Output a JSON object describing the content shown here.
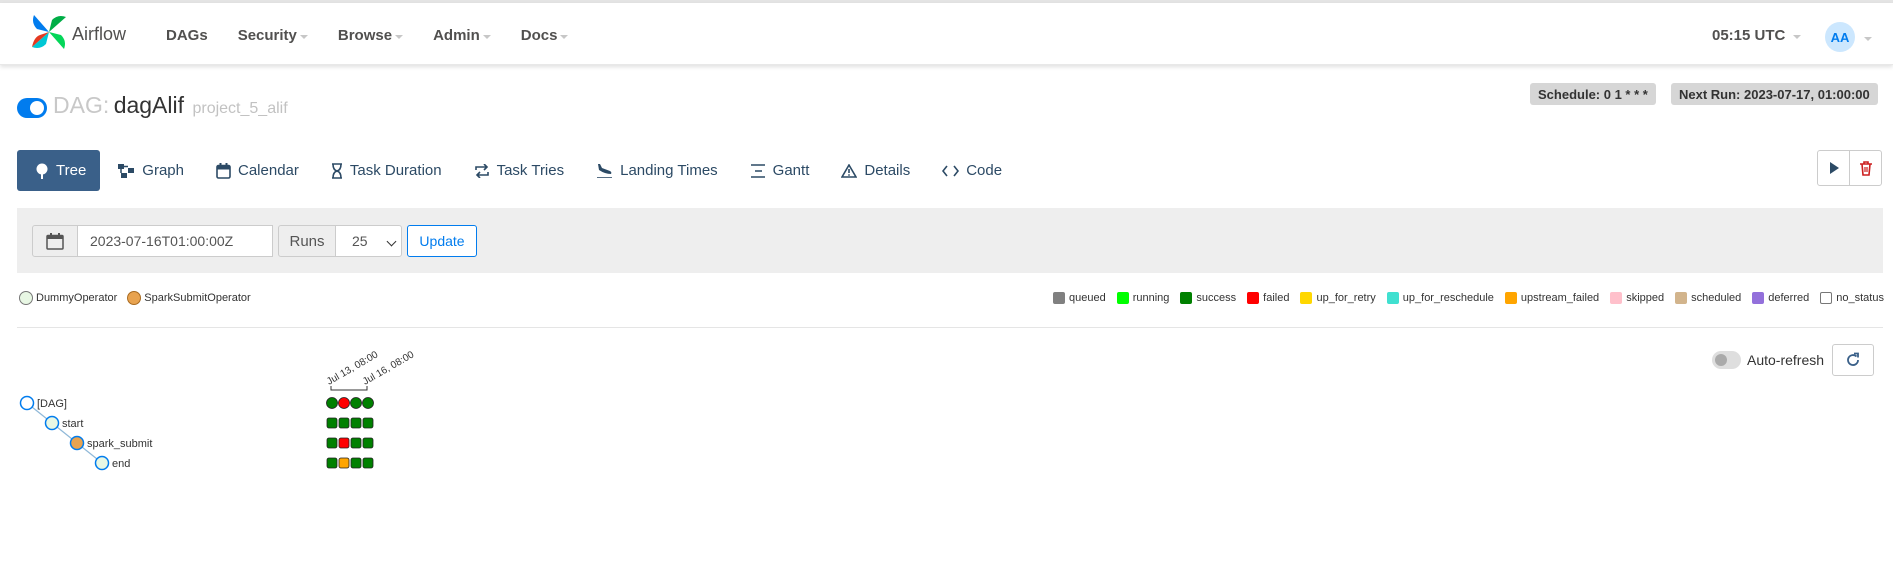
{
  "app": {
    "brand": "Airflow"
  },
  "nav": {
    "menu": [
      {
        "label": "DAGs",
        "dropdown": false
      },
      {
        "label": "Security",
        "dropdown": true
      },
      {
        "label": "Browse",
        "dropdown": true
      },
      {
        "label": "Admin",
        "dropdown": true
      },
      {
        "label": "Docs",
        "dropdown": true
      }
    ],
    "time": "05:15 UTC",
    "user_initials": "AA"
  },
  "dag": {
    "paused": false,
    "prefix": "DAG:",
    "name": "dagAlif",
    "tag": "project_5_alif",
    "schedule": "Schedule: 0 1 * * *",
    "next_run": "Next Run: 2023-07-17, 01:00:00"
  },
  "tabs": [
    {
      "label": "Tree",
      "icon": "tree-icon",
      "active": true
    },
    {
      "label": "Graph",
      "icon": "graph-icon",
      "active": false
    },
    {
      "label": "Calendar",
      "icon": "calendar-icon",
      "active": false
    },
    {
      "label": "Task Duration",
      "icon": "hourglass-icon",
      "active": false
    },
    {
      "label": "Task Tries",
      "icon": "retry-icon",
      "active": false
    },
    {
      "label": "Landing Times",
      "icon": "plane-landing-icon",
      "active": false
    },
    {
      "label": "Gantt",
      "icon": "gantt-icon",
      "active": false
    },
    {
      "label": "Details",
      "icon": "warning-triangle-icon",
      "active": false
    },
    {
      "label": "Code",
      "icon": "code-icon",
      "active": false
    }
  ],
  "filter": {
    "base_date": "2023-07-16T01:00:00Z",
    "runs_label": "Runs",
    "runs_value": "25",
    "update_label": "Update"
  },
  "operators": [
    {
      "label": "DummyOperator",
      "color": "#e8f7e4"
    },
    {
      "label": "SparkSubmitOperator",
      "color": "#e8a350"
    }
  ],
  "states": [
    {
      "label": "queued",
      "color": "#808080",
      "border": "#808080"
    },
    {
      "label": "running",
      "color": "#00ff00",
      "border": "#00ff00"
    },
    {
      "label": "success",
      "color": "#008000",
      "border": "#008000"
    },
    {
      "label": "failed",
      "color": "#ff0000",
      "border": "#ff0000"
    },
    {
      "label": "up_for_retry",
      "color": "#ffd700",
      "border": "#ffd700"
    },
    {
      "label": "up_for_reschedule",
      "color": "#40e0d0",
      "border": "#40e0d0"
    },
    {
      "label": "upstream_failed",
      "color": "#ffa500",
      "border": "#ffa500"
    },
    {
      "label": "skipped",
      "color": "#ffc0cb",
      "border": "#ffc0cb"
    },
    {
      "label": "scheduled",
      "color": "#d2b48c",
      "border": "#d2b48c"
    },
    {
      "label": "deferred",
      "color": "#9370db",
      "border": "#9370db"
    },
    {
      "label": "no_status",
      "color": "#ffffff",
      "border": "#777777"
    }
  ],
  "tree": {
    "run_labels": [
      "Jul 13, 08:00",
      "Jul 16, 08:00"
    ],
    "nodes": [
      {
        "label": "[DAG]",
        "depth": 0,
        "operator": "none"
      },
      {
        "label": "start",
        "depth": 1,
        "operator": "DummyOperator"
      },
      {
        "label": "spark_submit",
        "depth": 2,
        "operator": "SparkSubmitOperator"
      },
      {
        "label": "end",
        "depth": 3,
        "operator": "DummyOperator"
      }
    ],
    "dag_runs": [
      "success",
      "failed",
      "success",
      "success"
    ],
    "task_instances": [
      [
        "success",
        "success",
        "success",
        "success"
      ],
      [
        "success",
        "failed",
        "success",
        "success"
      ],
      [
        "success",
        "upstream_failed",
        "success",
        "success"
      ]
    ]
  },
  "autorefresh": {
    "label": "Auto-refresh",
    "enabled": false
  },
  "colors": {
    "accent": "#017cee",
    "tab_active": "#3a6089",
    "tab_text": "#2c4a65"
  }
}
